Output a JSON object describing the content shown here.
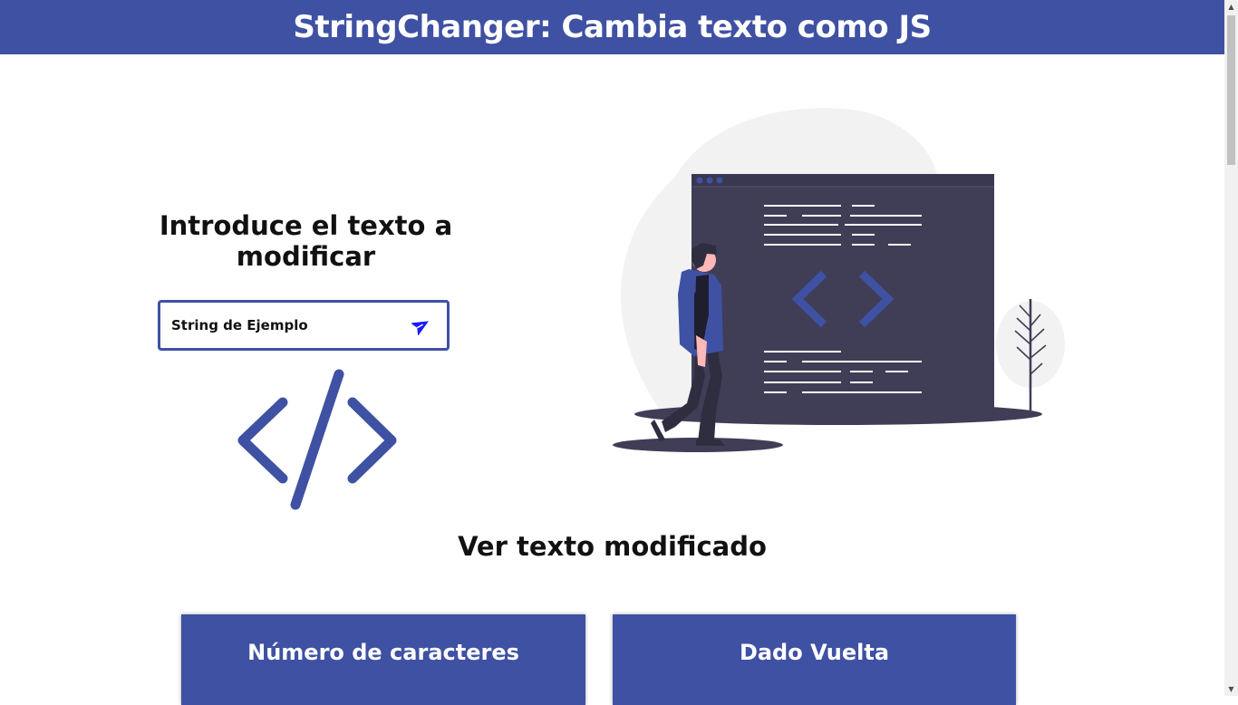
{
  "header": {
    "title": "StringChanger: Cambia texto como JS"
  },
  "intro": {
    "title": "Introduce el texto a modificar"
  },
  "input": {
    "value": "String de Ejemplo",
    "send_icon": "paper-plane-icon"
  },
  "decor": {
    "code_icon": "code-slash-icon",
    "illustration": "developer-at-code-window"
  },
  "results": {
    "title": "Ver texto modificado",
    "cards": [
      {
        "title": "Número de caracteres"
      },
      {
        "title": "Dado Vuelta"
      }
    ]
  },
  "colors": {
    "accent": "#3f51a3",
    "dark_window": "#403d56",
    "blob": "#f2f2f2",
    "send_icon": "#1a1aff"
  }
}
